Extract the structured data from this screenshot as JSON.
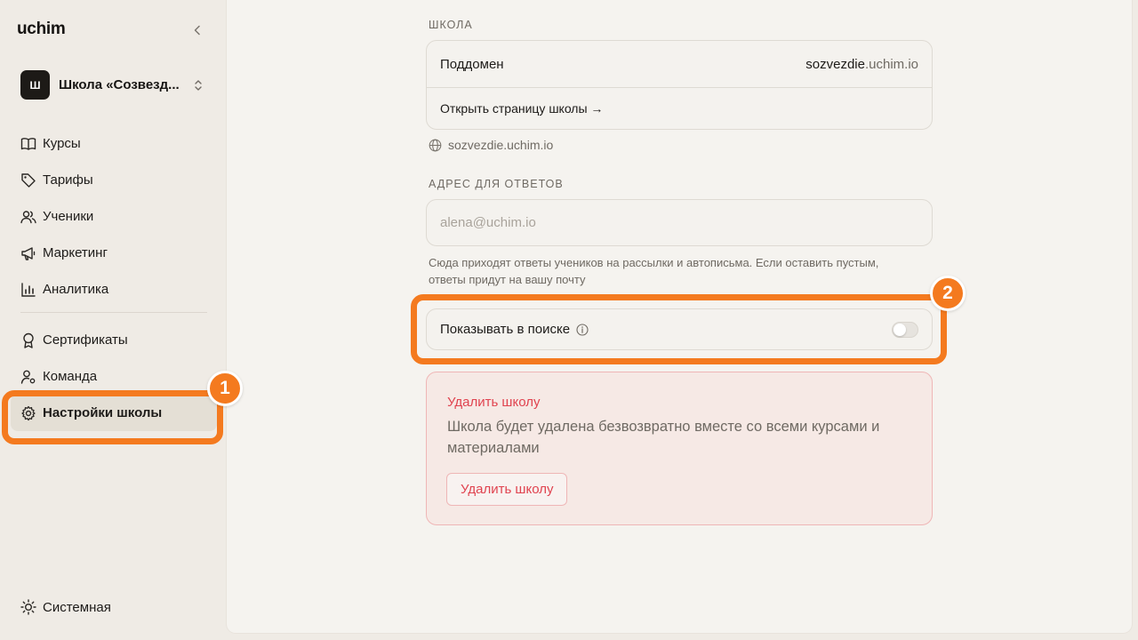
{
  "app": {
    "logo": "uchim"
  },
  "school": {
    "avatar_letter": "Ш",
    "name": "Школа «Созвезд..."
  },
  "nav": {
    "items": [
      {
        "label": "Курсы",
        "icon": "book-icon"
      },
      {
        "label": "Тарифы",
        "icon": "tag-icon"
      },
      {
        "label": "Ученики",
        "icon": "users-icon"
      },
      {
        "label": "Маркетинг",
        "icon": "megaphone-icon"
      },
      {
        "label": "Аналитика",
        "icon": "bar-chart-icon"
      }
    ],
    "secondary": [
      {
        "label": "Сертификаты",
        "icon": "award-icon"
      },
      {
        "label": "Команда",
        "icon": "user-settings-icon"
      },
      {
        "label": "Настройки школы",
        "icon": "gear-icon",
        "active": true
      }
    ],
    "theme_label": "Системная"
  },
  "settings": {
    "school_section_label": "ШКОЛА",
    "subdomain_label": "Поддомен",
    "subdomain_value_main": "sozvezdie",
    "subdomain_value_suffix": ".uchim.io",
    "open_page_link": "Открыть страницу школы →",
    "site_url": "sozvezdie.uchim.io",
    "reply_section_label": "АДРЕС ДЛЯ ОТВЕТОВ",
    "reply_placeholder": "alena@uchim.io",
    "reply_value": "",
    "reply_hint_line1": "Сюда приходят ответы учеников на рассылки и автописьма. Если оставить пустым,",
    "reply_hint_line2": "ответы придут на вашу почту",
    "search_toggle_label": "Показывать в поиске",
    "search_toggle_on": false
  },
  "danger_zone": {
    "title": "Удалить школу",
    "text_line1": "Школа будет удалена безвозвратно вместе со всеми курсами и",
    "text_line2": "материалами",
    "button_label": "Удалить школу"
  },
  "annotations": [
    {
      "number": "1"
    },
    {
      "number": "2"
    }
  ],
  "colors": {
    "accent_highlight": "#f47a1f",
    "danger": "#e0434f",
    "sidebar_bg": "#efebe5",
    "main_bg": "#f5f3ef"
  }
}
